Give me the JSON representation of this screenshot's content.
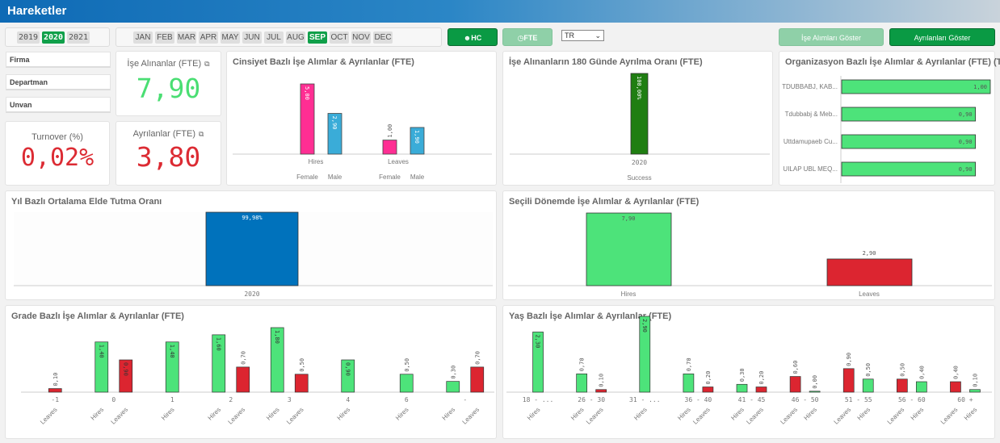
{
  "app": {
    "title": "Hareketler"
  },
  "years": {
    "items": [
      "2019",
      "2020",
      "2021"
    ],
    "selected": "2020"
  },
  "months": {
    "items": [
      "JAN",
      "FEB",
      "MAR",
      "APR",
      "MAY",
      "JUN",
      "JUL",
      "AUG",
      "SEP",
      "OCT",
      "NOV",
      "DEC"
    ],
    "selected": "SEP"
  },
  "toolbar": {
    "hc_label": "HC",
    "hc_icon": "users-icon",
    "fte_label": "FTE",
    "fte_icon": "clock-icon",
    "language_select": {
      "value": "TR"
    },
    "show_hires_label": "İşe Alımları Göster",
    "show_leaves_label": "Ayrılanları Göster"
  },
  "filters": [
    "Firma",
    "Departman",
    "Unvan"
  ],
  "kpis": {
    "hires": {
      "label": "İşe Alınanlar (FTE)",
      "value": "7,90",
      "color": "#4ade73"
    },
    "turnover": {
      "label": "Turnover (%)",
      "value": "0,02%",
      "color": "#dc2b33"
    },
    "leaves": {
      "label": "Ayrılanlar (FTE)",
      "value": "3,80",
      "color": "#dc2b33"
    }
  },
  "colors": {
    "hires": "#4de37a",
    "leaves": "#dc2530",
    "female": "#ff2e93",
    "male": "#3aacd8",
    "success": "#1f7e12",
    "retention": "#0072bc"
  },
  "chart_data": [
    {
      "id": "gender",
      "type": "bar",
      "title": "Cinsiyet Bazlı İşe Alımlar & Ayrılanlar (FTE)",
      "categories": [
        "Hires",
        "Leaves"
      ],
      "subcategories": [
        "Female",
        "Male"
      ],
      "series": [
        {
          "name": "Female",
          "values": [
            5.0,
            1.0
          ],
          "labels": [
            "5,00",
            "1,00"
          ]
        },
        {
          "name": "Male",
          "values": [
            2.9,
            1.9
          ],
          "labels": [
            "2,90",
            "1,90"
          ]
        }
      ]
    },
    {
      "id": "success180",
      "type": "bar",
      "title": "İşe Alınanların 180 Günde Ayrılma Oranı (FTE)",
      "categories": [
        "2020"
      ],
      "xlabel": "Success",
      "values": [
        100.0
      ],
      "labels": [
        "100,00%"
      ]
    },
    {
      "id": "org",
      "type": "bar",
      "orientation": "horizontal",
      "title": "Organizasyon Bazlı İşe Alımlar & Ayrılanlar (FTE) (To...",
      "categories": [
        "TDUBBABJ, KAB...",
        "Tdubbabj & Meb...",
        "Uttdamupaeb Cu...",
        "UILAP UBL MEQ..."
      ],
      "values": [
        1.0,
        0.9,
        0.9,
        0.9
      ],
      "labels": [
        "1,00",
        "0,90",
        "0,90",
        "0,90"
      ]
    },
    {
      "id": "retention",
      "type": "bar",
      "title": "Yıl Bazlı Ortalama Elde Tutma Oranı",
      "categories": [
        "2020"
      ],
      "values": [
        99.98
      ],
      "labels": [
        "99,98%"
      ]
    },
    {
      "id": "period",
      "type": "bar",
      "title": "Seçili Dönemde İşe Alımlar & Ayrılanlar (FTE)",
      "categories": [
        "Hires",
        "Leaves"
      ],
      "values": [
        7.9,
        2.9
      ],
      "labels": [
        "7,90",
        "2,90"
      ]
    },
    {
      "id": "grade",
      "type": "bar",
      "title": "Grade Bazlı İşe Alımlar & Ayrılanlar (FTE)",
      "groups": [
        {
          "name": "-1",
          "bars": [
            {
              "type": "Leaves",
              "value": 0.1,
              "label": "0,10"
            }
          ]
        },
        {
          "name": "0",
          "bars": [
            {
              "type": "Hires",
              "value": 1.4,
              "label": "1,40"
            },
            {
              "type": "Leaves",
              "value": 0.9,
              "label": "0,90"
            }
          ]
        },
        {
          "name": "1",
          "bars": [
            {
              "type": "Hires",
              "value": 1.4,
              "label": "1,40"
            }
          ]
        },
        {
          "name": "2",
          "bars": [
            {
              "type": "Hires",
              "value": 1.6,
              "label": "1,60"
            },
            {
              "type": "Leaves",
              "value": 0.7,
              "label": "0,70"
            }
          ]
        },
        {
          "name": "3",
          "bars": [
            {
              "type": "Hires",
              "value": 1.8,
              "label": "1,80"
            },
            {
              "type": "Leaves",
              "value": 0.5,
              "label": "0,50"
            }
          ]
        },
        {
          "name": "4",
          "bars": [
            {
              "type": "Hires",
              "value": 0.9,
              "label": "0,90"
            }
          ]
        },
        {
          "name": "6",
          "bars": [
            {
              "type": "Hires",
              "value": 0.5,
              "label": "0,50"
            }
          ]
        },
        {
          "name": "-",
          "bars": [
            {
              "type": "Hires",
              "value": 0.3,
              "label": "0,30"
            },
            {
              "type": "Leaves",
              "value": 0.7,
              "label": "0,70"
            }
          ]
        }
      ]
    },
    {
      "id": "age",
      "type": "bar",
      "title": "Yaş Bazlı İşe Alımlar & Ayrılanlar (FTE)",
      "groups": [
        {
          "name": "18 - ...",
          "bars": [
            {
              "type": "Hires",
              "value": 2.3,
              "label": "2,30"
            }
          ]
        },
        {
          "name": "26 - 30",
          "bars": [
            {
              "type": "Hires",
              "value": 0.7,
              "label": "0,70"
            },
            {
              "type": "Leaves",
              "value": 0.1,
              "label": "0,10"
            }
          ]
        },
        {
          "name": "31 - ...",
          "bars": [
            {
              "type": "Hires",
              "value": 2.9,
              "label": "2,90"
            }
          ]
        },
        {
          "name": "36 - 40",
          "bars": [
            {
              "type": "Hires",
              "value": 0.7,
              "label": "0,70"
            },
            {
              "type": "Leaves",
              "value": 0.2,
              "label": "0,20"
            }
          ]
        },
        {
          "name": "41 - 45",
          "bars": [
            {
              "type": "Hires",
              "value": 0.3,
              "label": "0,30"
            },
            {
              "type": "Leaves",
              "value": 0.2,
              "label": "0,20"
            }
          ]
        },
        {
          "name": "46 - 50",
          "bars": [
            {
              "type": "Leaves",
              "value": 0.6,
              "label": "0,60"
            },
            {
              "type": "Hires",
              "value": 0.0,
              "label": "0,00"
            }
          ]
        },
        {
          "name": "51 - 55",
          "bars": [
            {
              "type": "Leaves",
              "value": 0.9,
              "label": "0,90"
            },
            {
              "type": "Hires",
              "value": 0.5,
              "label": "0,50"
            }
          ]
        },
        {
          "name": "56 - 60",
          "bars": [
            {
              "type": "Leaves",
              "value": 0.5,
              "label": "0,50"
            },
            {
              "type": "Hires",
              "value": 0.4,
              "label": "0,40"
            }
          ]
        },
        {
          "name": "60 +",
          "bars": [
            {
              "type": "Leaves",
              "value": 0.4,
              "label": "0,40"
            },
            {
              "type": "Hires",
              "value": 0.1,
              "label": "0,10"
            }
          ]
        }
      ]
    }
  ]
}
